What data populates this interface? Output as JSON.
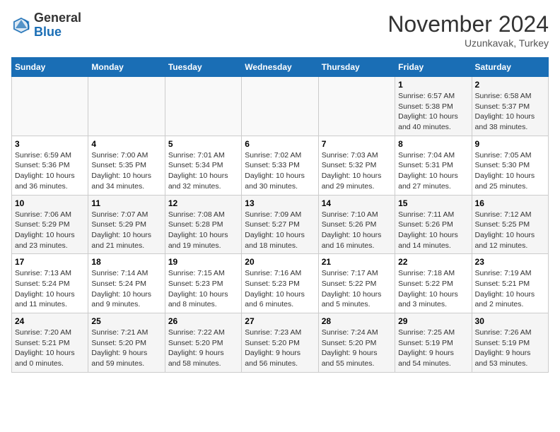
{
  "header": {
    "logo_line1": "General",
    "logo_line2": "Blue",
    "month_title": "November 2024",
    "location": "Uzunkavak, Turkey"
  },
  "weekdays": [
    "Sunday",
    "Monday",
    "Tuesday",
    "Wednesday",
    "Thursday",
    "Friday",
    "Saturday"
  ],
  "weeks": [
    [
      {
        "day": "",
        "info": ""
      },
      {
        "day": "",
        "info": ""
      },
      {
        "day": "",
        "info": ""
      },
      {
        "day": "",
        "info": ""
      },
      {
        "day": "",
        "info": ""
      },
      {
        "day": "1",
        "info": "Sunrise: 6:57 AM\nSunset: 5:38 PM\nDaylight: 10 hours\nand 40 minutes."
      },
      {
        "day": "2",
        "info": "Sunrise: 6:58 AM\nSunset: 5:37 PM\nDaylight: 10 hours\nand 38 minutes."
      }
    ],
    [
      {
        "day": "3",
        "info": "Sunrise: 6:59 AM\nSunset: 5:36 PM\nDaylight: 10 hours\nand 36 minutes."
      },
      {
        "day": "4",
        "info": "Sunrise: 7:00 AM\nSunset: 5:35 PM\nDaylight: 10 hours\nand 34 minutes."
      },
      {
        "day": "5",
        "info": "Sunrise: 7:01 AM\nSunset: 5:34 PM\nDaylight: 10 hours\nand 32 minutes."
      },
      {
        "day": "6",
        "info": "Sunrise: 7:02 AM\nSunset: 5:33 PM\nDaylight: 10 hours\nand 30 minutes."
      },
      {
        "day": "7",
        "info": "Sunrise: 7:03 AM\nSunset: 5:32 PM\nDaylight: 10 hours\nand 29 minutes."
      },
      {
        "day": "8",
        "info": "Sunrise: 7:04 AM\nSunset: 5:31 PM\nDaylight: 10 hours\nand 27 minutes."
      },
      {
        "day": "9",
        "info": "Sunrise: 7:05 AM\nSunset: 5:30 PM\nDaylight: 10 hours\nand 25 minutes."
      }
    ],
    [
      {
        "day": "10",
        "info": "Sunrise: 7:06 AM\nSunset: 5:29 PM\nDaylight: 10 hours\nand 23 minutes."
      },
      {
        "day": "11",
        "info": "Sunrise: 7:07 AM\nSunset: 5:29 PM\nDaylight: 10 hours\nand 21 minutes."
      },
      {
        "day": "12",
        "info": "Sunrise: 7:08 AM\nSunset: 5:28 PM\nDaylight: 10 hours\nand 19 minutes."
      },
      {
        "day": "13",
        "info": "Sunrise: 7:09 AM\nSunset: 5:27 PM\nDaylight: 10 hours\nand 18 minutes."
      },
      {
        "day": "14",
        "info": "Sunrise: 7:10 AM\nSunset: 5:26 PM\nDaylight: 10 hours\nand 16 minutes."
      },
      {
        "day": "15",
        "info": "Sunrise: 7:11 AM\nSunset: 5:26 PM\nDaylight: 10 hours\nand 14 minutes."
      },
      {
        "day": "16",
        "info": "Sunrise: 7:12 AM\nSunset: 5:25 PM\nDaylight: 10 hours\nand 12 minutes."
      }
    ],
    [
      {
        "day": "17",
        "info": "Sunrise: 7:13 AM\nSunset: 5:24 PM\nDaylight: 10 hours\nand 11 minutes."
      },
      {
        "day": "18",
        "info": "Sunrise: 7:14 AM\nSunset: 5:24 PM\nDaylight: 10 hours\nand 9 minutes."
      },
      {
        "day": "19",
        "info": "Sunrise: 7:15 AM\nSunset: 5:23 PM\nDaylight: 10 hours\nand 8 minutes."
      },
      {
        "day": "20",
        "info": "Sunrise: 7:16 AM\nSunset: 5:23 PM\nDaylight: 10 hours\nand 6 minutes."
      },
      {
        "day": "21",
        "info": "Sunrise: 7:17 AM\nSunset: 5:22 PM\nDaylight: 10 hours\nand 5 minutes."
      },
      {
        "day": "22",
        "info": "Sunrise: 7:18 AM\nSunset: 5:22 PM\nDaylight: 10 hours\nand 3 minutes."
      },
      {
        "day": "23",
        "info": "Sunrise: 7:19 AM\nSunset: 5:21 PM\nDaylight: 10 hours\nand 2 minutes."
      }
    ],
    [
      {
        "day": "24",
        "info": "Sunrise: 7:20 AM\nSunset: 5:21 PM\nDaylight: 10 hours\nand 0 minutes."
      },
      {
        "day": "25",
        "info": "Sunrise: 7:21 AM\nSunset: 5:20 PM\nDaylight: 9 hours\nand 59 minutes."
      },
      {
        "day": "26",
        "info": "Sunrise: 7:22 AM\nSunset: 5:20 PM\nDaylight: 9 hours\nand 58 minutes."
      },
      {
        "day": "27",
        "info": "Sunrise: 7:23 AM\nSunset: 5:20 PM\nDaylight: 9 hours\nand 56 minutes."
      },
      {
        "day": "28",
        "info": "Sunrise: 7:24 AM\nSunset: 5:20 PM\nDaylight: 9 hours\nand 55 minutes."
      },
      {
        "day": "29",
        "info": "Sunrise: 7:25 AM\nSunset: 5:19 PM\nDaylight: 9 hours\nand 54 minutes."
      },
      {
        "day": "30",
        "info": "Sunrise: 7:26 AM\nSunset: 5:19 PM\nDaylight: 9 hours\nand 53 minutes."
      }
    ]
  ]
}
